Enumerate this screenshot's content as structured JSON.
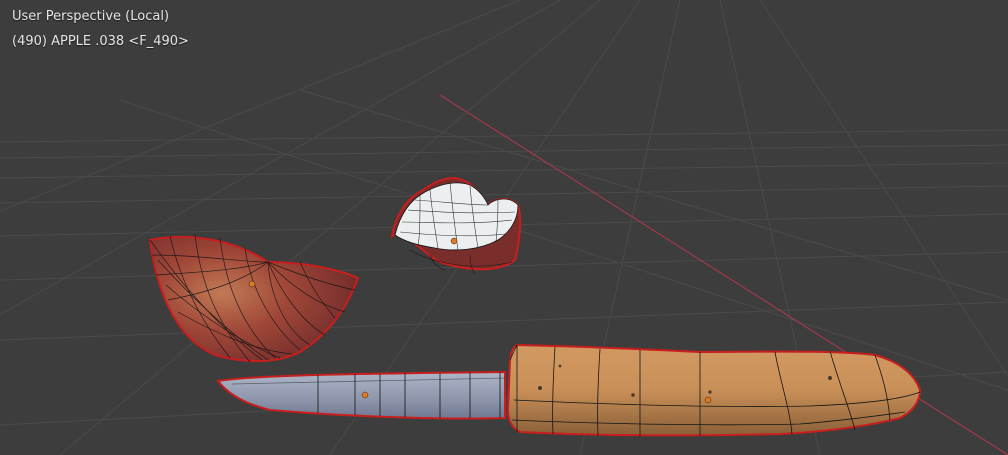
{
  "viewport": {
    "view_name": "User Perspective (Local)",
    "object_info": "(490) APPLE .038 <F_490>"
  },
  "scene": {
    "objects": [
      {
        "name": "apple-half",
        "kind": "mesh"
      },
      {
        "name": "apple-slice",
        "kind": "mesh"
      },
      {
        "name": "knife",
        "kind": "mesh"
      }
    ]
  },
  "colors": {
    "background": "#3d3d3d",
    "grid": "#4a4a4a",
    "x_axis": "#a03a4a",
    "selection_outline": "#c81e1e",
    "origin_dot": "#e07a20",
    "wireframe": "#151515"
  }
}
